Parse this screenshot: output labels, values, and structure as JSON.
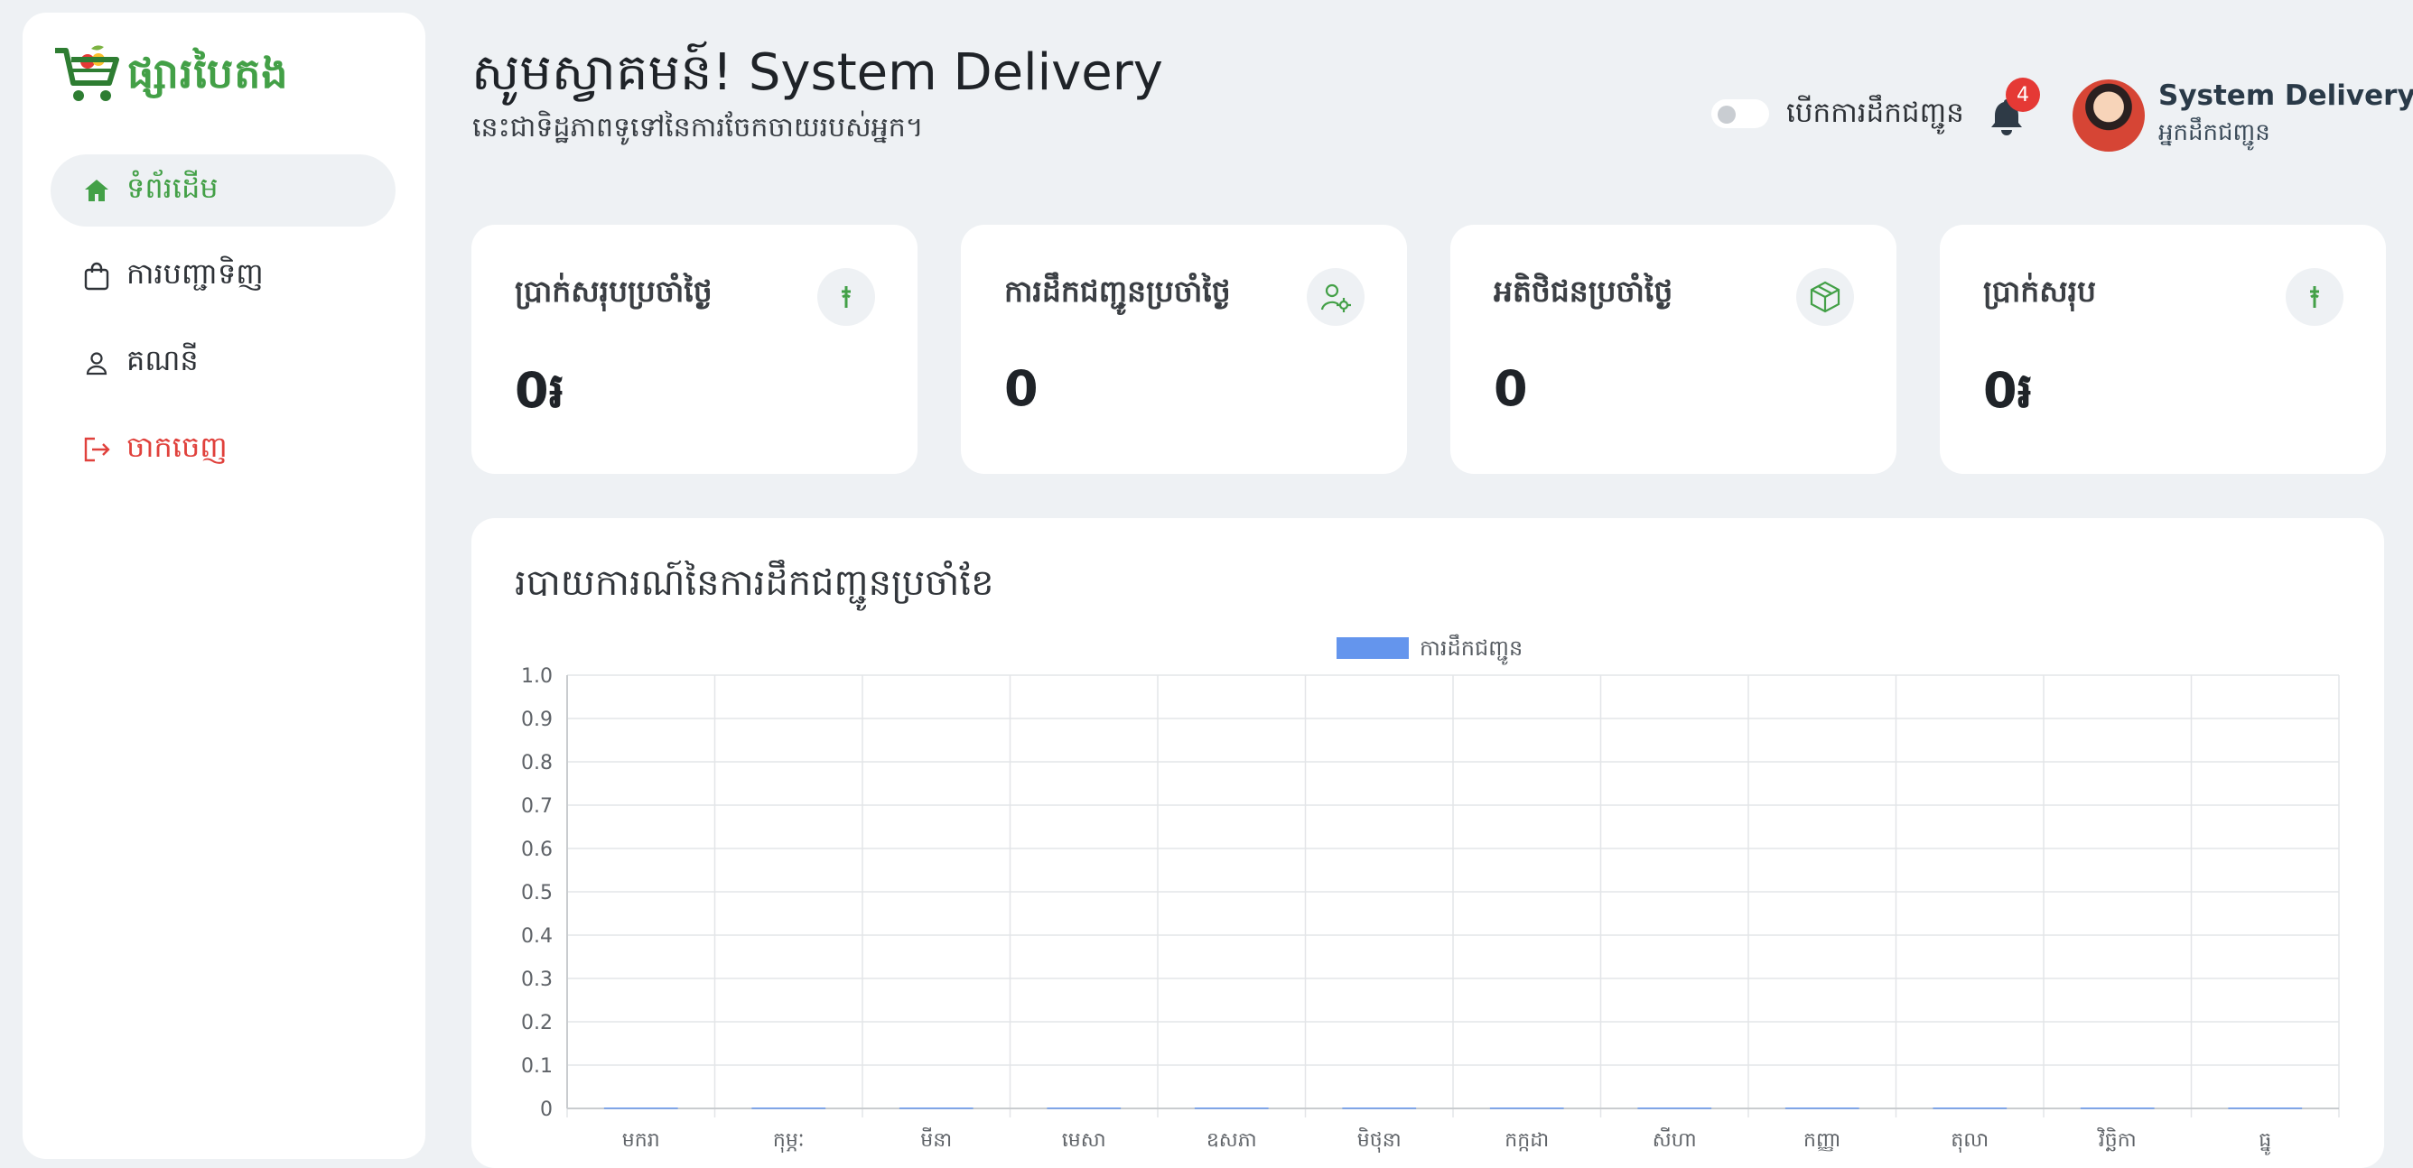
{
  "brand": {
    "name": "ផ្សារបៃតង",
    "accent": "#43a047"
  },
  "nav": {
    "items": [
      {
        "label": "ទំព័រដើម",
        "icon": "home-icon",
        "active": true
      },
      {
        "label": "ការបញ្ជាទិញ",
        "icon": "shopping-bag-icon",
        "active": false
      },
      {
        "label": "គណនី",
        "icon": "user-icon",
        "active": false
      }
    ],
    "logout": {
      "label": "ចាកចេញ",
      "icon": "logout-icon",
      "color": "#e0413c"
    }
  },
  "header": {
    "welcome": "សូមស្វាគមន៍! System Delivery",
    "subtitle": "នេះជាទិដ្ឋភាពទូទៅនៃការចែកចាយរបស់អ្នក។",
    "toggle_label": "បើកការដឹកជញ្ជូន",
    "toggle_on": false,
    "notification_count": "4",
    "user_name": "System Delivery",
    "user_role": "អ្នកដឹកជញ្ជូន"
  },
  "stats": [
    {
      "title": "ប្រាក់សរុបប្រចាំថ្ងៃ",
      "value": "0៛",
      "icon": "riel-icon"
    },
    {
      "title": "ការដឹកជញ្ជូនប្រចាំថ្ងៃ",
      "value": "0",
      "icon": "user-cog-icon"
    },
    {
      "title": "អតិថិជនប្រចាំថ្ងៃ",
      "value": "0",
      "icon": "box-icon"
    },
    {
      "title": "ប្រាក់សរុប",
      "value": "0៛",
      "icon": "riel-icon"
    }
  ],
  "chart": {
    "title": "របាយការណ៍នៃការដឹកជញ្ជូនប្រចាំខែ"
  },
  "chart_data": {
    "type": "bar",
    "title": "",
    "series": [
      {
        "name": "ការដឹកជញ្ជូន",
        "color": "#6495ed",
        "values": [
          0,
          0,
          0,
          0,
          0,
          0,
          0,
          0,
          0,
          0,
          0,
          0
        ]
      }
    ],
    "categories": [
      "មករា",
      "កុម្ភៈ",
      "មីនា",
      "មេសា",
      "ឧសភា",
      "មិថុនា",
      "កក្កដា",
      "សីហា",
      "កញ្ញា",
      "តុលា",
      "វិច្ឆិកា",
      "ធ្នូ"
    ],
    "y_ticks": [
      "1.0",
      "0.9",
      "0.8",
      "0.7",
      "0.6",
      "0.5",
      "0.4",
      "0.3",
      "0.2",
      "0.1",
      "0"
    ],
    "ylim": [
      0,
      1
    ],
    "grid": true,
    "legend": "top-center"
  }
}
